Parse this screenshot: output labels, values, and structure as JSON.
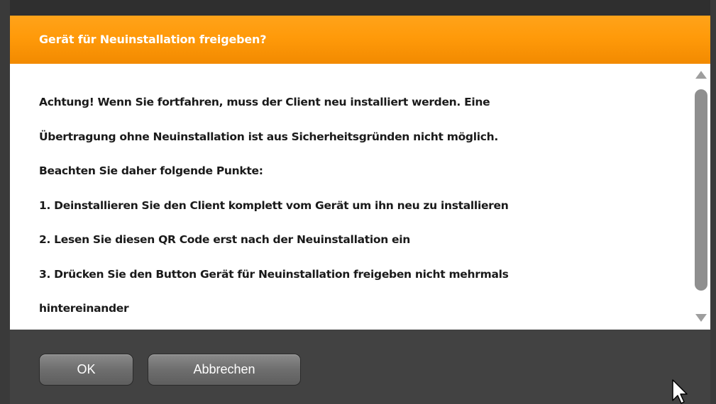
{
  "dialog": {
    "title": "Gerät für Neuinstallation freigeben?",
    "message_lines": [
      "Achtung! Wenn Sie fortfahren, muss der Client neu installiert werden. Eine",
      "Übertragung ohne Neuinstallation ist aus Sicherheitsgründen nicht möglich.",
      "Beachten Sie daher folgende Punkte:",
      "1. Deinstallieren Sie den Client komplett vom Gerät um ihn neu zu installieren",
      "2. Lesen Sie diesen QR Code erst nach der Neuinstallation ein",
      "3. Drücken Sie den Button Gerät für Neuinstallation freigeben nicht mehrmals",
      "hintereinander"
    ],
    "ok_label": "OK",
    "cancel_label": "Abbrechen"
  },
  "colors": {
    "title_bar": "#ff9a0a",
    "footer": "#424242",
    "button": "#6e6e6e",
    "text": "#1a1a1a"
  },
  "icons": {
    "scroll_up": "scroll-up-arrow-icon",
    "scroll_down": "scroll-down-arrow-icon",
    "cursor": "mouse-pointer-icon"
  }
}
